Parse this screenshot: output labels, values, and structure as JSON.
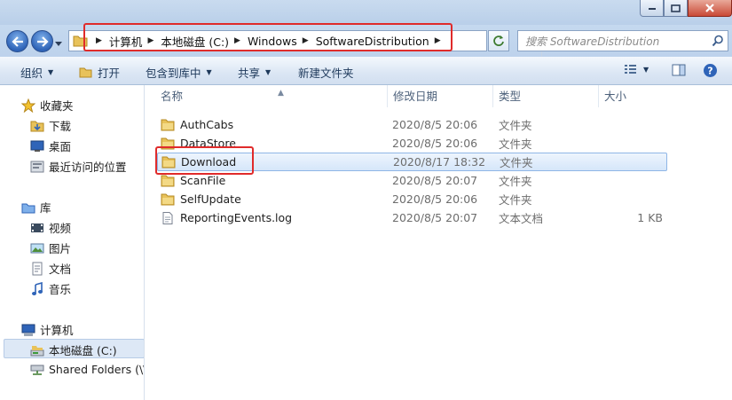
{
  "address": {
    "crumbs": [
      "计算机",
      "本地磁盘 (C:)",
      "Windows",
      "SoftwareDistribution"
    ]
  },
  "search": {
    "placeholder": "搜索 SoftwareDistribution"
  },
  "toolbar": {
    "organize": "组织",
    "open": "打开",
    "include_in_library": "包含到库中",
    "share": "共享",
    "new_folder": "新建文件夹"
  },
  "nav": {
    "favorites": "收藏夹",
    "downloads": "下载",
    "desktop": "桌面",
    "recent": "最近访问的位置",
    "libraries": "库",
    "videos": "视频",
    "pictures": "图片",
    "documents": "文档",
    "music": "音乐",
    "computer": "计算机",
    "local_disk": "本地磁盘 (C:)",
    "shared_folders": "Shared Folders (\\\\"
  },
  "columns": {
    "name": "名称",
    "date": "修改日期",
    "type": "类型",
    "size": "大小"
  },
  "files": [
    {
      "name": "AuthCabs",
      "date": "2020/8/5 20:06",
      "type": "文件夹",
      "size": "",
      "icon": "folder-icon"
    },
    {
      "name": "DataStore",
      "date": "2020/8/5 20:06",
      "type": "文件夹",
      "size": "",
      "icon": "folder-icon"
    },
    {
      "name": "Download",
      "date": "2020/8/17 18:32",
      "type": "文件夹",
      "size": "",
      "icon": "folder-icon"
    },
    {
      "name": "ScanFile",
      "date": "2020/8/5 20:07",
      "type": "文件夹",
      "size": "",
      "icon": "folder-icon"
    },
    {
      "name": "SelfUpdate",
      "date": "2020/8/5 20:06",
      "type": "文件夹",
      "size": "",
      "icon": "folder-icon"
    },
    {
      "name": "ReportingEvents.log",
      "date": "2020/8/5 20:07",
      "type": "文本文档",
      "size": "1 KB",
      "icon": "text-file-icon"
    }
  ],
  "colors": {
    "highlight_box": "#e02b2b",
    "selection": "#d5e6fa"
  }
}
